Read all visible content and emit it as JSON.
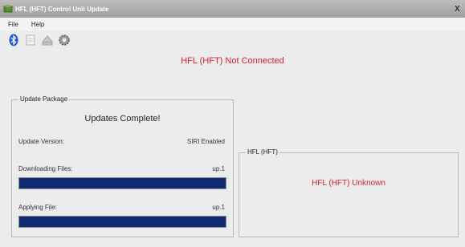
{
  "window": {
    "title": "HFL (HFT) Control Unit Update",
    "close_glyph": "x"
  },
  "menu": {
    "items": [
      "File",
      "Help"
    ]
  },
  "toolbar": {
    "icons": [
      "bluetooth-icon",
      "document-icon",
      "eject-icon",
      "gear-icon"
    ]
  },
  "status": {
    "connection": "HFL (HFT) Not Connected",
    "color": "#d3222a"
  },
  "update_package": {
    "legend": "Update Package",
    "complete_text": "Updates Complete!",
    "version_label": "Update Version:",
    "version_value": "SIRI Enabled",
    "download_label": "Downloading Files:",
    "download_value": "up.1",
    "download_progress": 1.0,
    "apply_label": "Applying File:",
    "apply_value": "up.1",
    "apply_progress": 1.0,
    "bar_color": "#0e2a72"
  },
  "hfl_panel": {
    "legend": "HFL (HFT)",
    "status": "HFL (HFT) Unknown"
  }
}
